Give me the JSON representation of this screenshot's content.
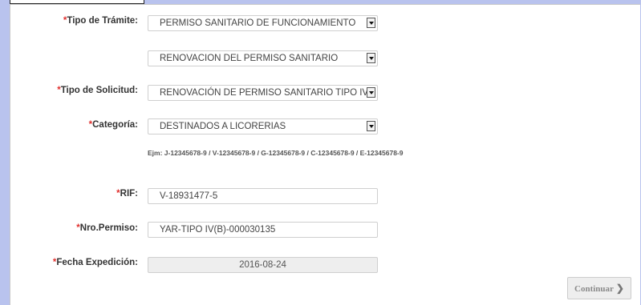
{
  "form": {
    "required_mark": "*",
    "tipo_tramite": {
      "label": "Tipo de Trámite:",
      "value": "PERMISO SANITARIO DE FUNCIONAMIENTO"
    },
    "sub_tramite": {
      "value": "RENOVACION DEL PERMISO SANITARIO"
    },
    "tipo_solicitud": {
      "label": "Tipo de Solicitud:",
      "value": "RENOVACIÓN DE PERMISO SANITARIO TIPO IV"
    },
    "categoria": {
      "label": "Categoría:",
      "value": "DESTINADOS A LICORERIAS"
    },
    "rif_hint": "Ejm: J-12345678-9 / V-12345678-9 / G-12345678-9 / C-12345678-9 / E-12345678-9",
    "rif": {
      "label": "RIF:",
      "value": "V-18931477-5"
    },
    "nro_permiso": {
      "label": "Nro.Permiso:",
      "value": "YAR-TIPO IV(B)-000030135"
    },
    "fecha_expedicion": {
      "label": "Fecha Expedición:",
      "value": "2016-08-24"
    }
  },
  "actions": {
    "continuar_label": "Continuar"
  },
  "icons": {
    "select_arrow": "chevron-down-icon",
    "continue_arrow": "chevron-right-icon"
  },
  "colors": {
    "required": "#e0302e",
    "background": "#b9c3ee"
  }
}
